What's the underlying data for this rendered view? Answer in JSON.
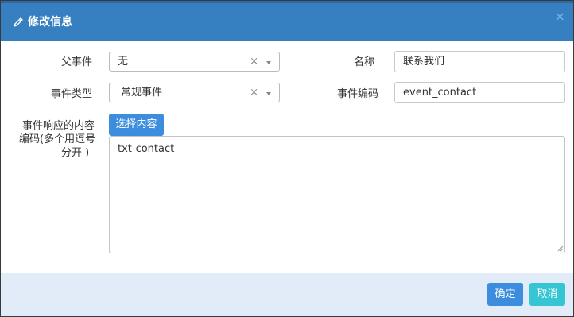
{
  "dialog": {
    "title": "修改信息",
    "close_glyph": "×"
  },
  "form": {
    "parent_event": {
      "label": "父事件",
      "value": "无",
      "clear_glyph": "×"
    },
    "name": {
      "label": "名称",
      "value": "联系我们"
    },
    "event_type": {
      "label": "事件类型",
      "value": "常规事件",
      "clear_glyph": "×"
    },
    "event_code": {
      "label": "事件编码",
      "value": "event_contact"
    },
    "response_codes": {
      "label_line1": "事件响应的内容",
      "label_line2": "编码(多个用逗号",
      "label_line3": "分开 )",
      "choose_button": "选择内容",
      "value": "txt-contact"
    }
  },
  "footer": {
    "ok_label": "确定",
    "cancel_label": "取消"
  },
  "colors": {
    "header_bg": "#3680c1",
    "primary_button": "#3c8dde",
    "cancel_button": "#36c6d3",
    "footer_bg": "#e2ecf8"
  },
  "icons": {
    "title_icon": "pencil-icon",
    "close_icon": "close-icon",
    "dropdown_icon": "caret-down-icon",
    "resize_icon": "resize-grip-icon"
  }
}
